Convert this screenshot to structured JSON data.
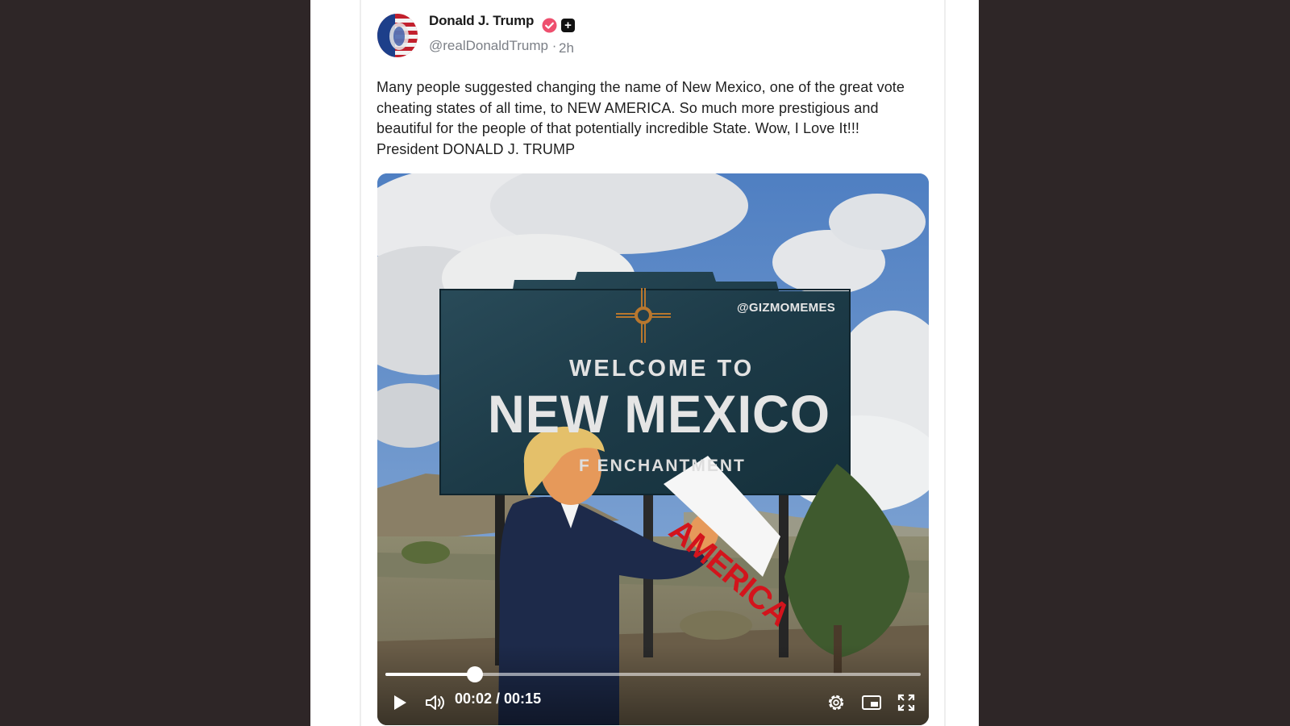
{
  "post": {
    "author_name": "Donald J. Trump",
    "handle": "@realDonaldTrump",
    "handle_separator": "·",
    "time_ago": "2h",
    "plus_badge": "+",
    "text": "Many people suggested changing the name of New Mexico, one of the great vote cheating states of all time, to NEW AMERICA. So much more prestigious and beautiful for the people of that potentially incredible State. Wow, I Love It!!! President DONALD J. TRUMP"
  },
  "video": {
    "watermark": "@GIZMOMEMES",
    "sign_line1": "WELCOME TO",
    "sign_line2": "NEW MEXICO",
    "sign_line3": "F ENCHANTMENT",
    "held_sign": "AMERICA",
    "current_time": "00:02",
    "duration": "00:15",
    "time_display": "00:02 / 00:15",
    "progress_fraction": 0.167
  },
  "icons": {
    "verified": "verified-badge-icon",
    "plus": "plus-badge-icon",
    "play": "play-icon",
    "volume": "volume-icon",
    "settings": "gear-icon",
    "pip": "picture-in-picture-icon",
    "fullscreen": "fullscreen-icon"
  },
  "colors": {
    "background": "#2e2627",
    "verified_badge": "#ee4f6e",
    "text": "#1f1f1f",
    "muted": "#7b7f86"
  }
}
